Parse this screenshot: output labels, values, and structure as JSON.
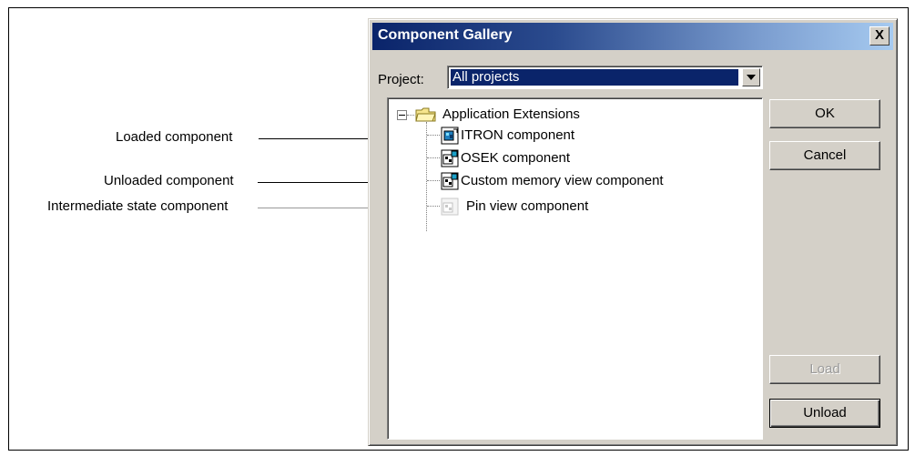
{
  "callouts": {
    "loaded": "Loaded component",
    "unloaded": "Unloaded component",
    "intermediate": "Intermediate state component"
  },
  "dialog": {
    "title": "Component Gallery",
    "close_symbol": "X",
    "project_label": "Project:",
    "project_value": "All projects"
  },
  "tree": {
    "root": "Application Extensions",
    "items": [
      {
        "label": "ITRON component",
        "state": "loaded"
      },
      {
        "label": "OSEK component",
        "state": "unloaded"
      },
      {
        "label": "Custom memory view component",
        "state": "unloaded"
      },
      {
        "label": "Pin view component",
        "state": "intermediate"
      }
    ]
  },
  "buttons": {
    "ok": "OK",
    "cancel": "Cancel",
    "load": "Load",
    "unload": "Unload"
  },
  "colors": {
    "title_gradient_start": "#0a246a",
    "title_gradient_end": "#a6caf0",
    "face": "#d4d0c8",
    "selection": "#0a246a"
  }
}
